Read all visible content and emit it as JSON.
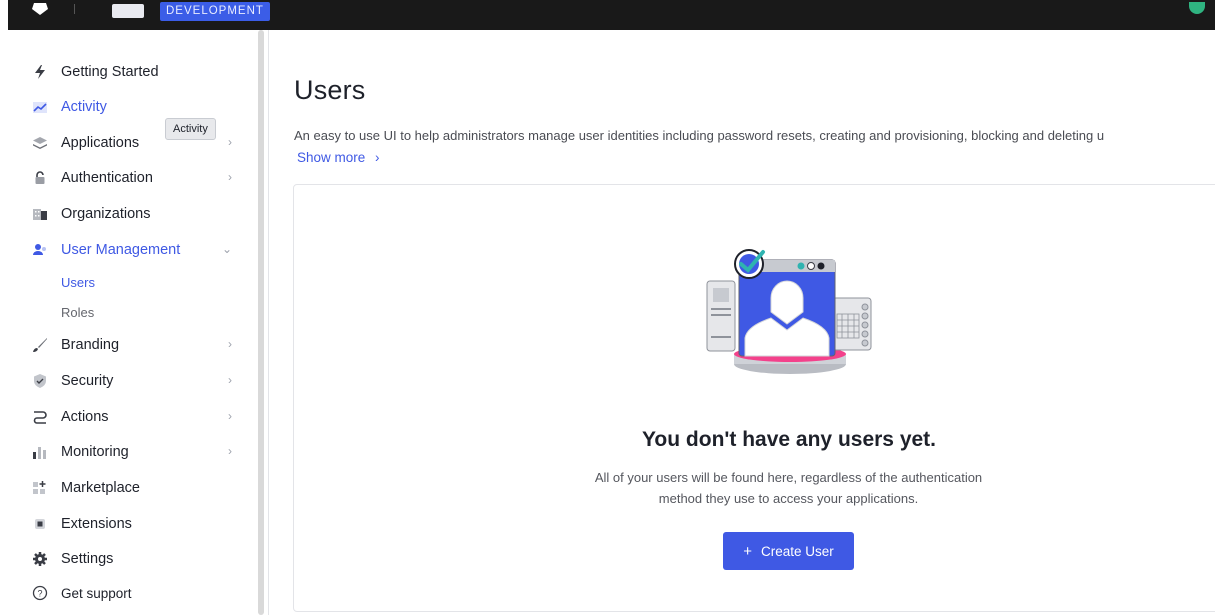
{
  "topbar": {
    "env_badge": "DEVELOPMENT"
  },
  "sidebar": {
    "items": [
      {
        "label": "Getting Started",
        "icon": "lightning-icon"
      },
      {
        "label": "Activity",
        "icon": "trend-chart-icon"
      },
      {
        "label": "Applications",
        "icon": "stack-icon"
      },
      {
        "label": "Authentication",
        "icon": "lock-icon"
      },
      {
        "label": "Organizations",
        "icon": "building-icon"
      },
      {
        "label": "User Management",
        "icon": "users-icon"
      },
      {
        "label": "Branding",
        "icon": "brush-icon"
      },
      {
        "label": "Security",
        "icon": "shield-icon"
      },
      {
        "label": "Actions",
        "icon": "flow-icon"
      },
      {
        "label": "Monitoring",
        "icon": "bar-chart-icon"
      },
      {
        "label": "Marketplace",
        "icon": "grid-plus-icon"
      },
      {
        "label": "Extensions",
        "icon": "chip-icon"
      },
      {
        "label": "Settings",
        "icon": "gear-icon"
      },
      {
        "label": "Get support",
        "icon": "help-icon"
      }
    ],
    "sub_items": [
      {
        "label": "Users"
      },
      {
        "label": "Roles"
      }
    ],
    "tooltip": "Activity",
    "active_color": "#3f59e4"
  },
  "main": {
    "title": "Users",
    "description": "An easy to use UI to help administrators manage user identities including password resets, creating and provisioning, blocking and deleting u",
    "show_more": "Show more",
    "empty_title": "You don't have any users yet.",
    "empty_text_line1": "All of your users will be found here, regardless of the authentication",
    "empty_text_line2": "method they use to access your applications.",
    "create_button": "Create User",
    "accent_color": "#3f59e4"
  }
}
